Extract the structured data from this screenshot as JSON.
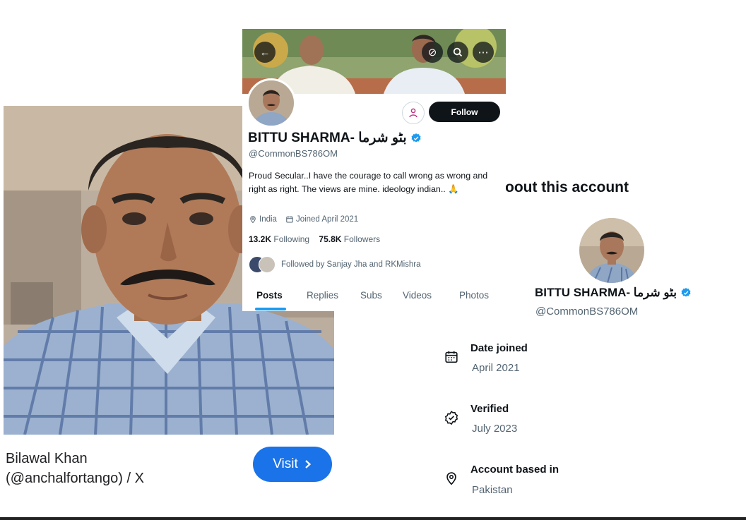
{
  "profile": {
    "name": "BITTU SHARMA- بٹو شرما",
    "handle": "@CommonBS786OM",
    "bio": "Proud Secular..I have the courage to call wrong as wrong and right as right. The views are mine. ideology indian.. 🙏",
    "location": "India",
    "joined": "Joined April 2021",
    "following_count": "13.2K",
    "following_label": "Following",
    "followers_count": "75.8K",
    "followers_label": "Followers",
    "followed_by": "Followed by Sanjay Jha and RKMishra",
    "follow_label": "Follow",
    "tabs": [
      "Posts",
      "Replies",
      "Subs",
      "Videos",
      "Photos"
    ],
    "active_tab": "Posts"
  },
  "about": {
    "title": "oout this account",
    "name": "BITTU SHARMA- بٹو شرما",
    "handle": "@CommonBS786OM",
    "items": [
      {
        "label": "Date joined",
        "value": "April 2021",
        "icon": "calendar-icon"
      },
      {
        "label": "Verified",
        "value": "July 2023",
        "icon": "verified-check-icon"
      },
      {
        "label": "Account based in",
        "value": "Pakistan",
        "icon": "location-pin-icon"
      }
    ]
  },
  "search_result": {
    "title_line1": "Bilawal Khan",
    "title_line2": "(@anchalfortango) / X",
    "visit_label": "Visit",
    "visit_icon": "chevron-right-icon"
  },
  "colors": {
    "x_blue": "#1d9bf0",
    "visit_blue": "#1a73e8",
    "follow_black": "#0f1419",
    "muted_text": "#536471"
  }
}
